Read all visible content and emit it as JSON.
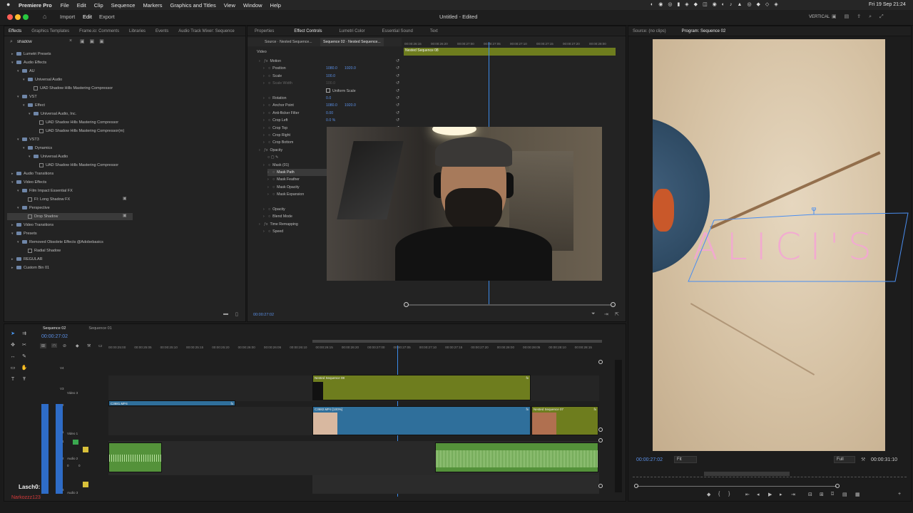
{
  "menubar": {
    "app": "Premiere Pro",
    "items": [
      "File",
      "Edit",
      "Clip",
      "Sequence",
      "Markers",
      "Graphics and Titles",
      "View",
      "Window",
      "Help"
    ],
    "right": "Fri 19 Sep  21:24",
    "vertical_label": "VERTICAL"
  },
  "header": {
    "workspaces": [
      "Import",
      "Edit",
      "Export"
    ],
    "title": "Untitled - Edited"
  },
  "effects_panel": {
    "tabs": [
      "Effects",
      "Graphics Templates",
      "Frame.io: Comments",
      "Libraries",
      "Events",
      "Audio Track Mixer: Sequence"
    ],
    "search_value": "shadow",
    "tree": [
      {
        "label": "Lumetri Presets",
        "level": 0,
        "tri": "▸",
        "folder": true
      },
      {
        "label": "Audio Effects",
        "level": 0,
        "tri": "▾",
        "folder": true
      },
      {
        "label": "AU",
        "level": 1,
        "tri": "▾",
        "folder": true
      },
      {
        "label": "Universal Audio",
        "level": 2,
        "tri": "▾",
        "folder": true
      },
      {
        "label": "UAD Shadow Hills Mastering Compressor",
        "level": 3,
        "tri": "",
        "folder": false
      },
      {
        "label": "VST",
        "level": 1,
        "tri": "▾",
        "folder": true
      },
      {
        "label": "Effect",
        "level": 2,
        "tri": "▾",
        "folder": true
      },
      {
        "label": "Universal Audio, Inc.",
        "level": 3,
        "tri": "▾",
        "folder": true
      },
      {
        "label": "UAD Shadow Hills Mastering Compressor",
        "level": 4,
        "tri": "",
        "folder": false
      },
      {
        "label": "UAD Shadow Hills Mastering Compressor(m)",
        "level": 4,
        "tri": "",
        "folder": false
      },
      {
        "label": "VST3",
        "level": 1,
        "tri": "▾",
        "folder": true
      },
      {
        "label": "Dynamics",
        "level": 2,
        "tri": "▾",
        "folder": true
      },
      {
        "label": "Universal Audio",
        "level": 3,
        "tri": "▾",
        "folder": true
      },
      {
        "label": "UAD Shadow Hills Mastering Compressor",
        "level": 4,
        "tri": "",
        "folder": false
      },
      {
        "label": "Audio Transitions",
        "level": 0,
        "tri": "▸",
        "folder": true
      },
      {
        "label": "Video Effects",
        "level": 0,
        "tri": "▾",
        "folder": true
      },
      {
        "label": "Film Impact Essential FX",
        "level": 1,
        "tri": "▾",
        "folder": true
      },
      {
        "label": "FI: Long Shadow FX",
        "level": 2,
        "tri": "",
        "folder": false
      },
      {
        "label": "Perspective",
        "level": 1,
        "tri": "▾",
        "folder": true
      },
      {
        "label": "Drop Shadow",
        "level": 2,
        "tri": "",
        "folder": false,
        "selected": true
      },
      {
        "label": "Video Transitions",
        "level": 0,
        "tri": "▸",
        "folder": true
      },
      {
        "label": "Presets",
        "level": 0,
        "tri": "▾",
        "folder": true
      },
      {
        "label": "Removed Obsolete Effects @Adobebasics",
        "level": 1,
        "tri": "▾",
        "folder": true
      },
      {
        "label": "Radial Shadow",
        "level": 2,
        "tri": "",
        "folder": false
      },
      {
        "label": "REGULAR",
        "level": 0,
        "tri": "▸",
        "folder": true
      },
      {
        "label": "Custom Bin 01",
        "level": 0,
        "tri": "▸",
        "folder": true
      }
    ]
  },
  "effect_controls": {
    "tabs": [
      "Properties",
      "Effect Controls",
      "Lumetri Color",
      "Essential Sound",
      "Text"
    ],
    "source_tab": "Source · Nested Sequence...",
    "seq_tab": "Sequence 02 · Nested Sequence...",
    "clip_label": "Nested Sequence 08",
    "section": "Video",
    "rows": [
      {
        "label": "Motion",
        "indent": 1,
        "fx": true
      },
      {
        "label": "Position",
        "indent": 2,
        "values": [
          "1080.0",
          "1920.0"
        ]
      },
      {
        "label": "Scale",
        "indent": 2,
        "values": [
          "100.0"
        ]
      },
      {
        "label": "Scale Width",
        "indent": 2,
        "values": [
          "100.0"
        ],
        "dim": true
      },
      {
        "label": "",
        "indent": 2,
        "values": [],
        "checkbox": "Uniform Scale"
      },
      {
        "label": "Rotation",
        "indent": 2,
        "values": [
          "0.0"
        ]
      },
      {
        "label": "Anchor Point",
        "indent": 2,
        "values": [
          "1080.0",
          "1920.0"
        ]
      },
      {
        "label": "Anti-flicker Filter",
        "indent": 2,
        "values": [
          "0.00"
        ]
      },
      {
        "label": "Crop Left",
        "indent": 2,
        "values": [
          "0.0 %"
        ]
      },
      {
        "label": "Crop Top",
        "indent": 2,
        "values": []
      },
      {
        "label": "Crop Right",
        "indent": 2,
        "values": []
      },
      {
        "label": "Crop Bottom",
        "indent": 2,
        "values": []
      },
      {
        "label": "Opacity",
        "indent": 1,
        "fx": true
      },
      {
        "label": "",
        "indent": 2,
        "values": [],
        "shapes": true
      },
      {
        "label": "Mask (01)",
        "indent": 2
      },
      {
        "label": "Mask Path",
        "indent": 3,
        "selected": true
      },
      {
        "label": "Mask Feather",
        "indent": 3
      },
      {
        "label": "Mask Opacity",
        "indent": 3
      },
      {
        "label": "Mask Expansion",
        "indent": 3
      },
      {
        "label": "",
        "indent": 0
      },
      {
        "label": "Opacity",
        "indent": 2
      },
      {
        "label": "Blend Mode",
        "indent": 2
      },
      {
        "label": "Time Remapping",
        "indent": 1,
        "fx": true
      },
      {
        "label": "Speed",
        "indent": 2
      }
    ],
    "ruler": [
      "00:00:26:15",
      "00:00:26:20",
      "00:00:27:00",
      "00:00:27:05",
      "00:00:27:10",
      "00:00:27:15",
      "00:00:27:20",
      "00:00:28:00"
    ],
    "timecode": "00:00:27:02"
  },
  "program_monitor": {
    "tabs": [
      "Source: (no clips)",
      "Program: Sequence 02"
    ],
    "overlay_text": "ALICI'S",
    "timecode": "00:00:27:02",
    "fit": "Fit",
    "quality": "Full",
    "duration": "00:00:31:10"
  },
  "timeline": {
    "tabs": [
      "Sequence 02",
      "Sequence 01"
    ],
    "timecode": "00:00:27:02",
    "ruler": [
      "00:00:25:00",
      "00:00:25:05",
      "00:00:25:10",
      "00:00:25:15",
      "00:00:25:20",
      "00:00:26:00",
      "00:00:26:05",
      "00:00:26:10",
      "00:00:26:15",
      "00:00:26:20",
      "00:00:27:00",
      "00:00:27:05",
      "00:00:27:10",
      "00:00:27:15",
      "00:00:27:20",
      "00:00:28:00",
      "00:00:28:05",
      "00:00:28:10",
      "00:00:28:15"
    ],
    "track_names": {
      "v3": "Video 3",
      "v1": "Video 1",
      "a2": "Audio 2",
      "a3": "Audio 3"
    },
    "track_ids": [
      "V4",
      "V3",
      "V2",
      "V1",
      "A1",
      "A2",
      "A3"
    ],
    "clips": {
      "nested08": "Nested Sequence 08",
      "c3681": "C3681.MP4",
      "c3682": "C3682.MP4 [100%]",
      "nested07": "Nested Sequence 07",
      "fx": "fx"
    },
    "audio_meter_vals": [
      "0",
      "0"
    ],
    "overlay_user1": "Lasch0:",
    "overlay_user2": "Narkozzz123"
  },
  "colors": {
    "accent": "#2d8ceb",
    "clip_green": "#6e7d1e",
    "clip_blue": "#2f6f9b",
    "audio_green": "#54923a",
    "mask_pink": "#f4a7d4"
  }
}
